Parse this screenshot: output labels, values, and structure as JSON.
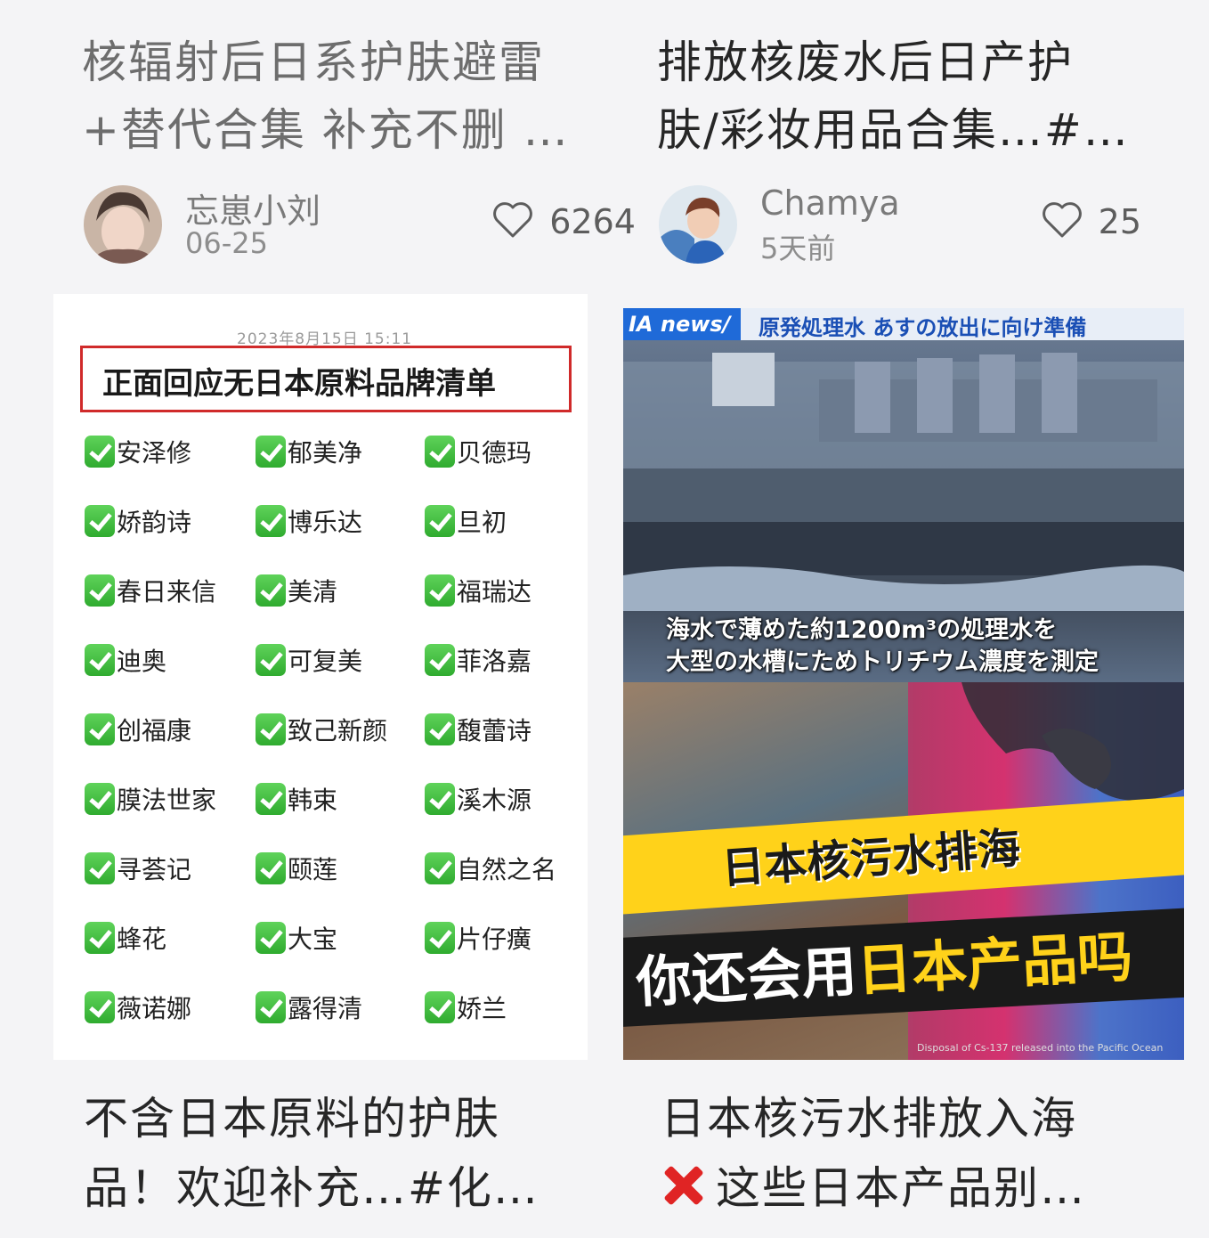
{
  "cards": [
    {
      "title_line1": "核辐射后日系护肤避雷",
      "title_line2": "+替代合集 补充不删 …",
      "author": "忘崽小刘",
      "date": "06-25",
      "likes": "6264"
    },
    {
      "title_line1": "排放核废水后日产护",
      "title_line2": "肤/彩妆用品合集…#…",
      "author": "Chamya",
      "date": "5天前",
      "likes": "25"
    },
    {
      "title_line1": "不含日本原料的护肤",
      "title_line2": "品！欢迎补充…#化…"
    },
    {
      "title_line1": "日本核污水排放入海",
      "title_line2": "这些日本产品别…"
    }
  ],
  "brand_list": {
    "timestamp": "2023年8月15日 15:11",
    "heading": "正面回应无日本原料品牌清单",
    "rows": [
      [
        "安泽修",
        "郁美净",
        "贝德玛"
      ],
      [
        "娇韵诗",
        "博乐达",
        "旦初"
      ],
      [
        "春日来信",
        "美清",
        "福瑞达"
      ],
      [
        "迪奥",
        "可复美",
        "菲洛嘉"
      ],
      [
        "创福康",
        "致己新颜",
        "馥蕾诗"
      ],
      [
        "膜法世家",
        "韩束",
        "溪木源"
      ],
      [
        "寻荟记",
        "颐莲",
        "自然之名"
      ],
      [
        "蜂花",
        "大宝",
        "片仔癀"
      ],
      [
        "薇诺娜",
        "露得清",
        "娇兰"
      ]
    ]
  },
  "news_image": {
    "logo": "IA news/",
    "headline": "原発処理水 あすの放出に向け準備",
    "caption_line1": "海水で薄めた約1200m³の処理水を",
    "caption_line2": "大型の水槽にためトリチウム濃度を測定",
    "banner_line1": "日本核污水排海",
    "banner_line2_prefix": "你还会用",
    "banner_line2_highlight": "日本产品吗",
    "footer": "Disposal of Cs-137 released into the Pacific Ocean"
  },
  "colors": {
    "page_bg": "#f4f4f6",
    "check_green": "#3cba3a",
    "highlight_red": "#d02a2a",
    "banner_yellow": "#ffd21a"
  },
  "icons": [
    "heart-outline-icon",
    "check-box-icon",
    "cross-mark-icon"
  ]
}
